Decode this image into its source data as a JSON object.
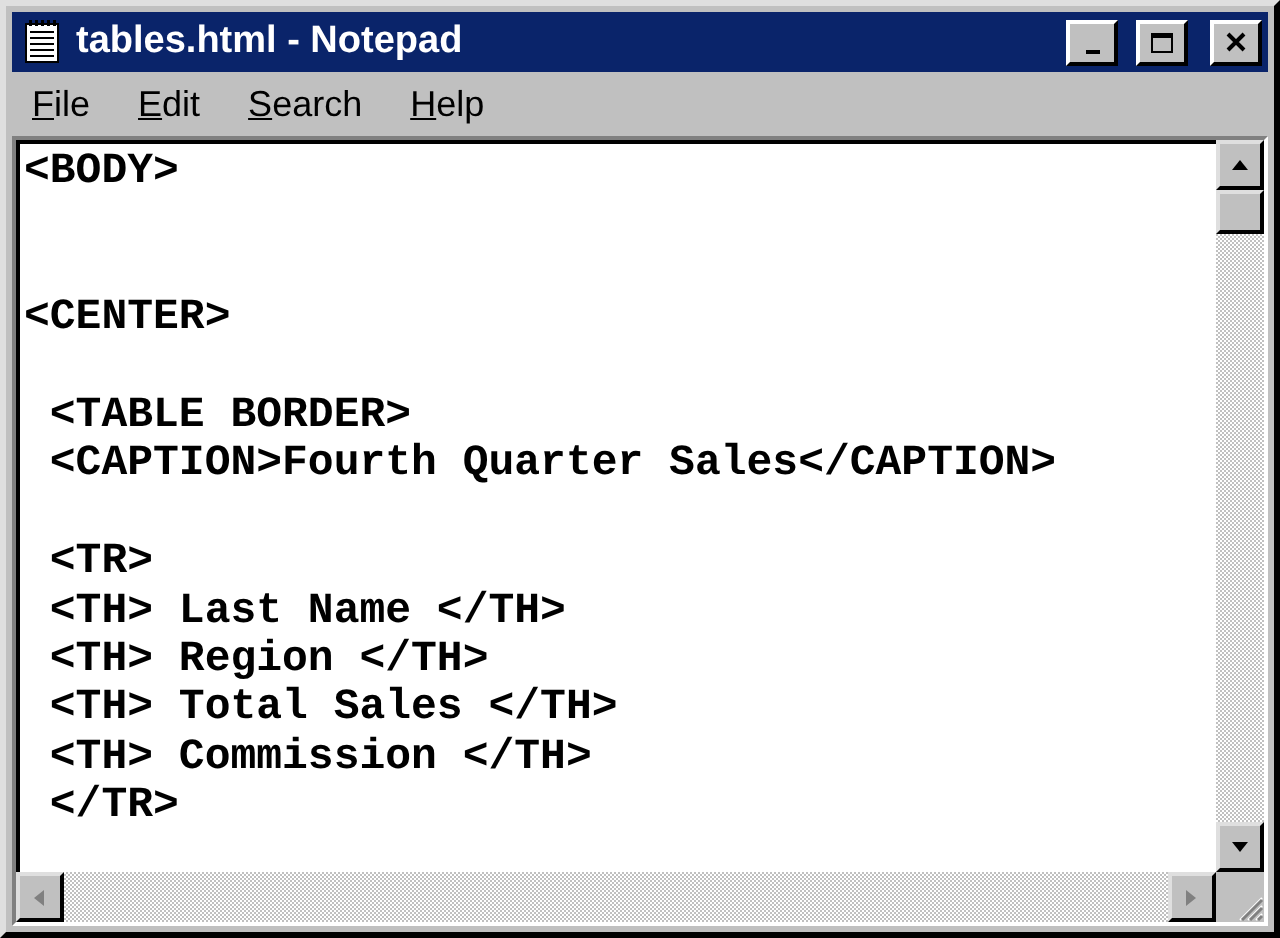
{
  "window": {
    "title": "tables.html - Notepad"
  },
  "menu": [
    {
      "mnemonic": "F",
      "rest": "ile"
    },
    {
      "mnemonic": "E",
      "rest": "dit"
    },
    {
      "mnemonic": "S",
      "rest": "earch"
    },
    {
      "mnemonic": "H",
      "rest": "elp"
    }
  ],
  "editor": {
    "text": "<BODY>\n\n\n<CENTER>\n\n <TABLE BORDER>\n <CAPTION>Fourth Quarter Sales</CAPTION>\n\n <TR>\n <TH> Last Name </TH>\n <TH> Region </TH>\n <TH> Total Sales </TH>\n <TH> Commission </TH>\n </TR>"
  }
}
